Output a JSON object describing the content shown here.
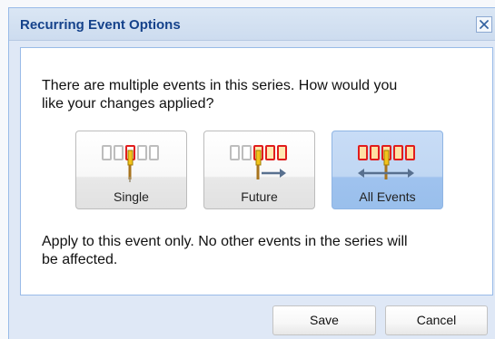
{
  "dialog": {
    "title": "Recurring Event Options",
    "prompt_line_1": "There are multiple events in this series. How would you",
    "prompt_line_2": "like your changes applied?",
    "description_line_1": "Apply to this event only. No other events in the series will",
    "description_line_2": "be affected.",
    "close_icon": "close-icon"
  },
  "options": [
    {
      "label": "Single",
      "icon": "single-event-icon",
      "selected": false
    },
    {
      "label": "Future",
      "icon": "future-events-icon",
      "selected": false
    },
    {
      "label": "All Events",
      "icon": "all-events-icon",
      "selected": true
    }
  ],
  "buttons": {
    "save": "Save",
    "cancel": "Cancel"
  },
  "colors": {
    "title": "#15428b",
    "window_background": "#dfe8f6",
    "selected_option": "#c8dcf6",
    "event_highlight": "#e11d1d",
    "slider_accent": "#f3c31b"
  }
}
